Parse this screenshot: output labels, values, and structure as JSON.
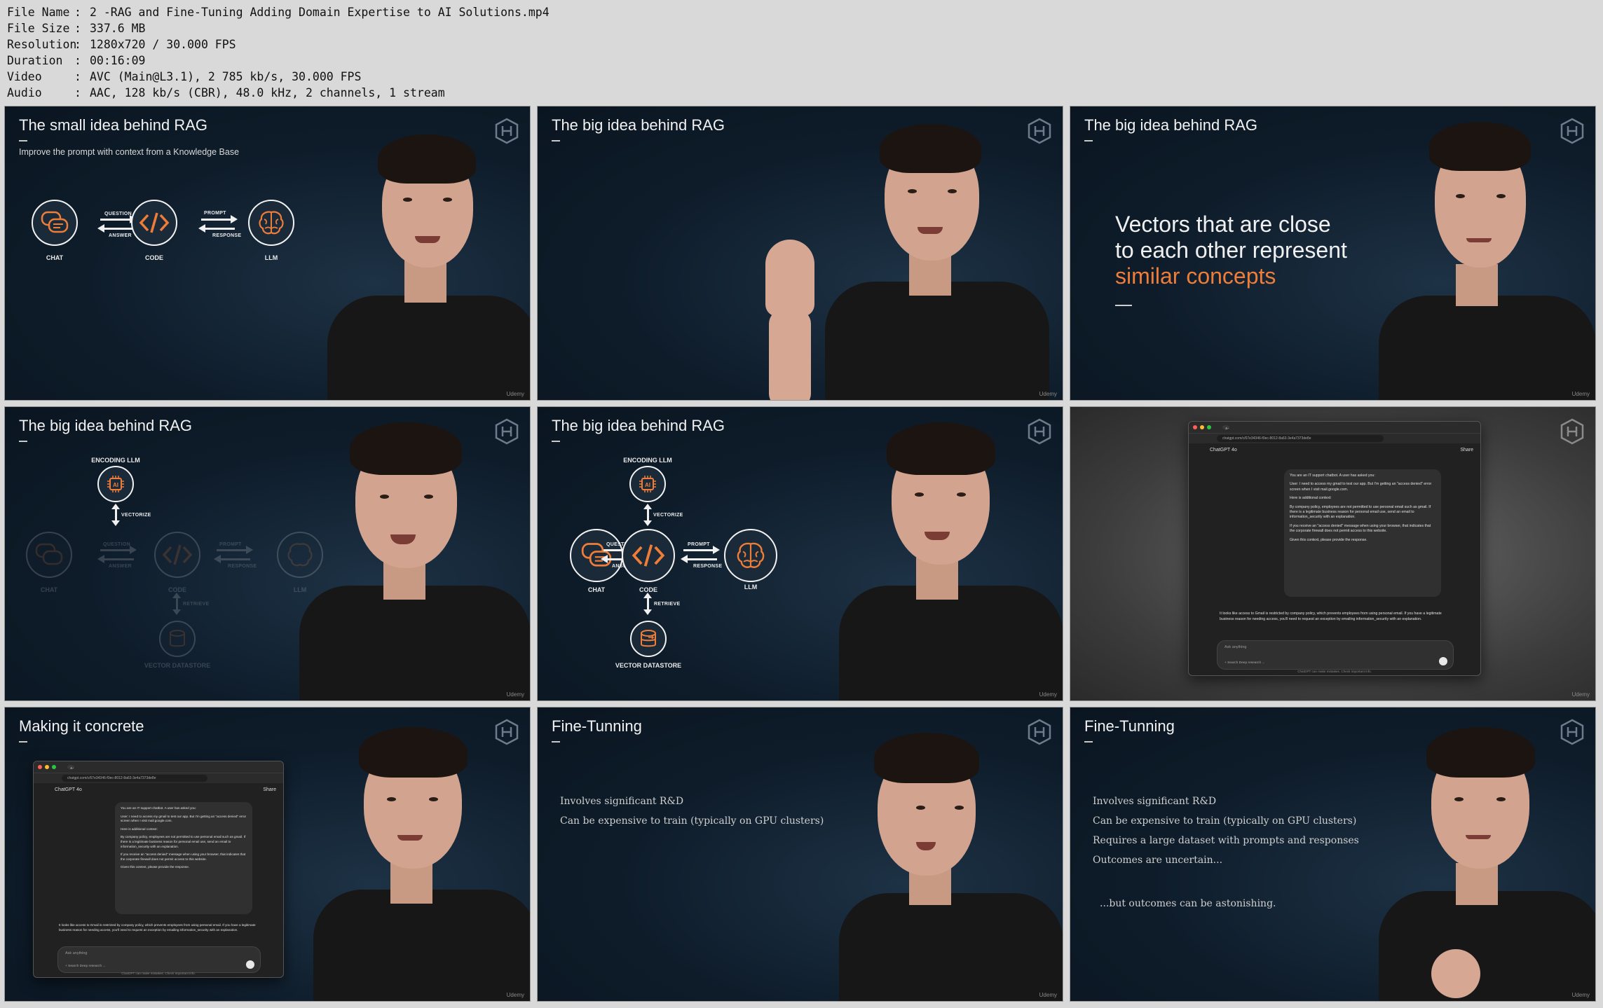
{
  "info": {
    "rows": [
      {
        "label": "File Name",
        "value": "2 -RAG and Fine-Tuning Adding Domain Expertise to AI Solutions.mp4"
      },
      {
        "label": "File Size",
        "value": "337.6 MB"
      },
      {
        "label": "Resolution",
        "value": "1280x720 / 30.000 FPS"
      },
      {
        "label": "Duration",
        "value": "00:16:09"
      },
      {
        "label": "Video",
        "value": "AVC (Main@L3.1), 2 785 kb/s, 30.000 FPS"
      },
      {
        "label": "Audio",
        "value": "AAC, 128 kb/s (CBR), 48.0 kHz, 2 channels, 1 stream"
      }
    ],
    "separator": ":"
  },
  "watermark": "Udemy",
  "colors": {
    "accent": "#ee7d3a",
    "slide_bg": "#0e1c2a"
  },
  "thumbs": {
    "t1": {
      "title": "The small idea behind RAG",
      "subtitle": "Improve the prompt with context from a Knowledge Base",
      "nodes": {
        "chat": "CHAT",
        "code": "CODE",
        "llm": "LLM"
      },
      "arrows": {
        "question": "QUESTION",
        "answer": "ANSWER",
        "prompt": "PROMPT",
        "response": "RESPONSE"
      }
    },
    "t2": {
      "title": "The big idea behind RAG"
    },
    "t3": {
      "title": "The big idea behind RAG",
      "line1": "Vectors that are close",
      "line2": "to each other represent",
      "line3": "similar concepts"
    },
    "t4": {
      "title": "The big idea behind RAG",
      "nodes": {
        "encoding": "ENCODING LLM",
        "chat": "CHAT",
        "code": "CODE",
        "llm": "LLM",
        "datastore": "VECTOR DATASTORE"
      },
      "arrows": {
        "vectorize": "VECTORIZE",
        "question": "QUESTION",
        "answer": "ANSWER",
        "prompt": "PROMPT",
        "response": "RESPONSE",
        "retrieve": "RETRIEVE"
      }
    },
    "t5": {
      "title": "The big idea behind RAG",
      "nodes": {
        "encoding": "ENCODING LLM",
        "chat": "CHAT",
        "code": "CODE",
        "llm": "LLM",
        "datastore": "VECTOR DATASTORE"
      },
      "arrows": {
        "vectorize": "VECTORIZE",
        "question": "QUESTION",
        "answer": "ANSWER",
        "prompt": "PROMPT",
        "response": "RESPONSE",
        "retrieve": "RETRIEVE"
      }
    },
    "t6": {
      "title": ""
    },
    "t7": {
      "title": "Making it concrete"
    },
    "t8": {
      "title": "Fine-Tunning",
      "items": [
        "Involves significant R&D",
        "Can be expensive to train (typically on GPU clusters)"
      ]
    },
    "t9": {
      "title": "Fine-Tunning",
      "items": [
        "Involves significant R&D",
        "Can be expensive to train (typically on GPU clusters)",
        "Requires a large dataset with prompts and responses",
        "Outcomes are uncertain..."
      ],
      "extra": "...but outcomes can be astonishing."
    }
  },
  "chat_ui": {
    "tab": "Access Denied Email Requ",
    "url": "chatgpt.com/c/67e34346-f0ec-8012-8a63-3e4a7373de8e",
    "model": "ChatGPT 4o",
    "share": "Share",
    "user_msg": [
      "You are an IT support chatbot. A user has asked you:",
      "User: I need to access my gmail to test our app. But I'm getting an \"access denied\" error screen when I visit mail.google.com.",
      "Here is additional context:",
      "By company policy, employees are not permitted to use personal email such as gmail. If there is a legitimate business reason for personal email use, send an email to information_security with an explanation.",
      "If you receive an \"access denied\" message when using your browser, that indicates that the corporate firewall does not permit access to this website.",
      "Given this context, please provide the response."
    ],
    "reply": "It looks like access to Gmail is restricted by company policy, which prevents employees from using personal email. If you have a legitimate business reason for needing access, you'll need to request an exception by emailing information_security with an explanation.",
    "placeholder": "Ask anything",
    "tools": "+   Search   Deep research   ...",
    "footer": "ChatGPT can make mistakes. Check important info."
  }
}
